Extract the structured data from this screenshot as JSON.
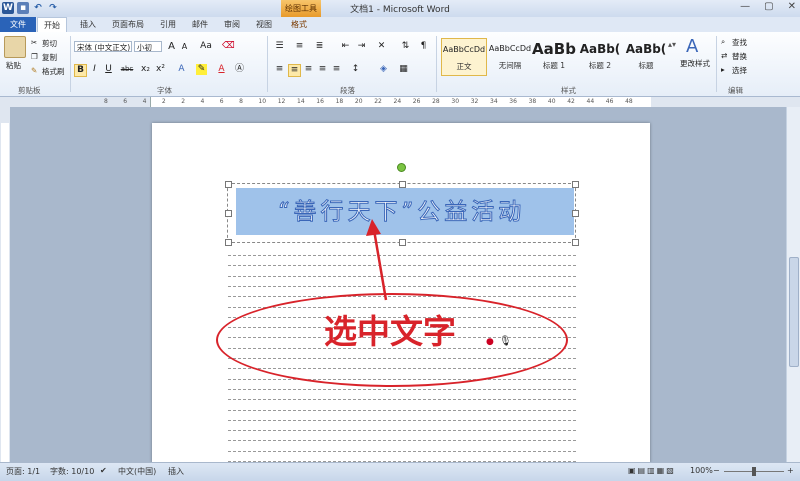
{
  "titlebar": {
    "title": "文档1 - Microsoft Word",
    "context_tab": "绘图工具",
    "minimize": "—",
    "maximize": "▢",
    "close": "✕"
  },
  "tabs": [
    "文件",
    "开始",
    "插入",
    "页面布局",
    "引用",
    "邮件",
    "审阅",
    "视图",
    "格式"
  ],
  "clipboard": {
    "paste": "粘贴",
    "cut": "剪切",
    "copy": "复制",
    "format_painter": "格式刷",
    "label": "剪贴板"
  },
  "font": {
    "name": "宋体 (中文正文)",
    "size": "小初",
    "label": "字体",
    "grow": "A",
    "shrink": "A",
    "aa": "Aa",
    "bold": "B",
    "italic": "I",
    "underline": "U",
    "strike": "abc",
    "sub": "x₂",
    "sup": "x²"
  },
  "paragraph": {
    "label": "段落"
  },
  "styles": {
    "label": "样式",
    "items": [
      {
        "preview": "AaBbCcDd",
        "name": "正文"
      },
      {
        "preview": "AaBbCcDd",
        "name": "无间隔"
      },
      {
        "preview": "AaBb",
        "name": "标题 1"
      },
      {
        "preview": "AaBb(",
        "name": "标题 2"
      },
      {
        "preview": "AaBb(",
        "name": "标题"
      }
    ],
    "change": "更改样式"
  },
  "editing": {
    "label": "编辑",
    "find": "查找",
    "replace": "替换",
    "select": "选择"
  },
  "ruler_numbers": [
    "8",
    "6",
    "4",
    "2",
    "2",
    "4",
    "6",
    "8",
    "10",
    "12",
    "14",
    "16",
    "18",
    "20",
    "22",
    "24",
    "26",
    "28",
    "30",
    "32",
    "34",
    "36",
    "38",
    "40",
    "42",
    "44",
    "46",
    "48"
  ],
  "document": {
    "title_text": "“善行天下”公益活动",
    "annotation": "选中文字"
  },
  "statusbar": {
    "page": "页面: 1/1",
    "words": "字数: 10/10",
    "lang": "中文(中国)",
    "mode": "插入",
    "zoom": "100%",
    "zoom_minus": "−",
    "zoom_plus": "+"
  }
}
